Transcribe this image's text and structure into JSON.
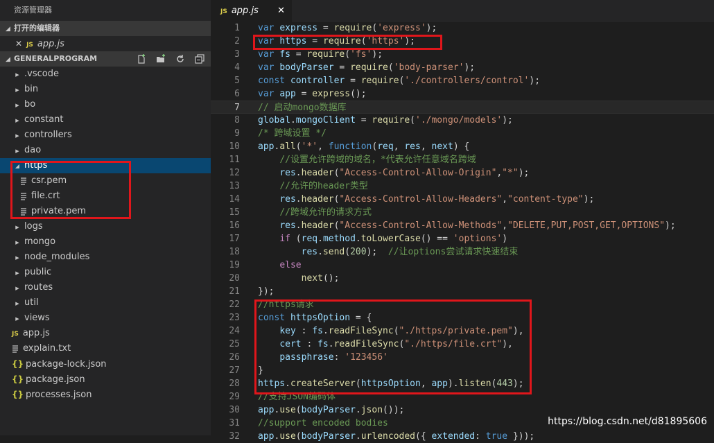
{
  "explorer_title": "资源管理器",
  "open_editors": {
    "header": "打开的编辑器",
    "items": [
      {
        "close": "✕",
        "badge": "JS",
        "name": "app.js"
      }
    ]
  },
  "project": {
    "header": "GENERALPROGRAM",
    "items": [
      {
        "name": ".vscode",
        "kind": "folder"
      },
      {
        "name": "bin",
        "kind": "folder"
      },
      {
        "name": "bo",
        "kind": "folder"
      },
      {
        "name": "constant",
        "kind": "folder"
      },
      {
        "name": "controllers",
        "kind": "folder"
      },
      {
        "name": "dao",
        "kind": "folder"
      },
      {
        "name": "https",
        "kind": "folder-open",
        "selected": true
      },
      {
        "name": "csr.pem",
        "kind": "file-lines",
        "child": true
      },
      {
        "name": "file.crt",
        "kind": "file-lines",
        "child": true
      },
      {
        "name": "private.pem",
        "kind": "file-lines",
        "child": true
      },
      {
        "name": "logs",
        "kind": "folder"
      },
      {
        "name": "mongo",
        "kind": "folder"
      },
      {
        "name": "node_modules",
        "kind": "folder"
      },
      {
        "name": "public",
        "kind": "folder"
      },
      {
        "name": "routes",
        "kind": "folder"
      },
      {
        "name": "util",
        "kind": "folder"
      },
      {
        "name": "views",
        "kind": "folder"
      },
      {
        "name": "app.js",
        "kind": "js"
      },
      {
        "name": "explain.txt",
        "kind": "file-lines"
      },
      {
        "name": "package-lock.json",
        "kind": "json"
      },
      {
        "name": "package.json",
        "kind": "json"
      },
      {
        "name": "processes.json",
        "kind": "json"
      }
    ]
  },
  "tab": {
    "badge": "JS",
    "name": "app.js",
    "close": "✕"
  },
  "code_lines": [
    [
      [
        "kw",
        "var"
      ],
      [
        "p",
        " "
      ],
      [
        "var",
        "express"
      ],
      [
        "p",
        " = "
      ],
      [
        "fn",
        "require"
      ],
      [
        "p",
        "("
      ],
      [
        "str",
        "'express'"
      ],
      [
        "p",
        ");"
      ]
    ],
    [
      [
        "kw",
        "var"
      ],
      [
        "p",
        " "
      ],
      [
        "var",
        "https"
      ],
      [
        "p",
        " = "
      ],
      [
        "fn",
        "require"
      ],
      [
        "p",
        "("
      ],
      [
        "str",
        "'https'"
      ],
      [
        "p",
        ");"
      ]
    ],
    [
      [
        "kw",
        "var"
      ],
      [
        "p",
        " "
      ],
      [
        "var",
        "fs"
      ],
      [
        "p",
        " = "
      ],
      [
        "fn",
        "require"
      ],
      [
        "p",
        "("
      ],
      [
        "str",
        "'fs'"
      ],
      [
        "p",
        ");"
      ]
    ],
    [
      [
        "kw",
        "var"
      ],
      [
        "p",
        " "
      ],
      [
        "var",
        "bodyParser"
      ],
      [
        "p",
        " = "
      ],
      [
        "fn",
        "require"
      ],
      [
        "p",
        "("
      ],
      [
        "str",
        "'body-parser'"
      ],
      [
        "p",
        ");"
      ]
    ],
    [
      [
        "kw",
        "const"
      ],
      [
        "p",
        " "
      ],
      [
        "var",
        "controller"
      ],
      [
        "p",
        " = "
      ],
      [
        "fn",
        "require"
      ],
      [
        "p",
        "("
      ],
      [
        "str",
        "'./controllers/control'"
      ],
      [
        "p",
        ");"
      ]
    ],
    [
      [
        "kw",
        "var"
      ],
      [
        "p",
        " "
      ],
      [
        "var",
        "app"
      ],
      [
        "p",
        " = "
      ],
      [
        "fn",
        "express"
      ],
      [
        "p",
        "();"
      ]
    ],
    [
      [
        "cm",
        "// 启动mongo数据库"
      ]
    ],
    [
      [
        "var",
        "global"
      ],
      [
        "p",
        "."
      ],
      [
        "var",
        "mongoClient"
      ],
      [
        "p",
        " = "
      ],
      [
        "fn",
        "require"
      ],
      [
        "p",
        "("
      ],
      [
        "str",
        "'./mongo/models'"
      ],
      [
        "p",
        ");"
      ]
    ],
    [
      [
        "cm",
        "/* 跨域设置 */"
      ]
    ],
    [
      [
        "var",
        "app"
      ],
      [
        "p",
        "."
      ],
      [
        "fn",
        "all"
      ],
      [
        "p",
        "("
      ],
      [
        "str",
        "'*'"
      ],
      [
        "p",
        ", "
      ],
      [
        "kw",
        "function"
      ],
      [
        "p",
        "("
      ],
      [
        "var",
        "req"
      ],
      [
        "p",
        ", "
      ],
      [
        "var",
        "res"
      ],
      [
        "p",
        ", "
      ],
      [
        "var",
        "next"
      ],
      [
        "p",
        ") {"
      ]
    ],
    [
      [
        "p",
        "    "
      ],
      [
        "cm",
        "//设置允许跨域的域名，*代表允许任意域名跨域"
      ]
    ],
    [
      [
        "p",
        "    "
      ],
      [
        "var",
        "res"
      ],
      [
        "p",
        "."
      ],
      [
        "fn",
        "header"
      ],
      [
        "p",
        "("
      ],
      [
        "str",
        "\"Access-Control-Allow-Origin\""
      ],
      [
        "p",
        ","
      ],
      [
        "str",
        "\"*\""
      ],
      [
        "p",
        ");"
      ]
    ],
    [
      [
        "p",
        "    "
      ],
      [
        "cm",
        "//允许的header类型"
      ]
    ],
    [
      [
        "p",
        "    "
      ],
      [
        "var",
        "res"
      ],
      [
        "p",
        "."
      ],
      [
        "fn",
        "header"
      ],
      [
        "p",
        "("
      ],
      [
        "str",
        "\"Access-Control-Allow-Headers\""
      ],
      [
        "p",
        ","
      ],
      [
        "str",
        "\"content-type\""
      ],
      [
        "p",
        ");"
      ]
    ],
    [
      [
        "p",
        "    "
      ],
      [
        "cm",
        "//跨域允许的请求方式"
      ]
    ],
    [
      [
        "p",
        "    "
      ],
      [
        "var",
        "res"
      ],
      [
        "p",
        "."
      ],
      [
        "fn",
        "header"
      ],
      [
        "p",
        "("
      ],
      [
        "str",
        "\"Access-Control-Allow-Methods\""
      ],
      [
        "p",
        ","
      ],
      [
        "str",
        "\"DELETE,PUT,POST,GET,OPTIONS\""
      ],
      [
        "p",
        ");"
      ]
    ],
    [
      [
        "p",
        "    "
      ],
      [
        "kw2",
        "if"
      ],
      [
        "p",
        " ("
      ],
      [
        "var",
        "req"
      ],
      [
        "p",
        "."
      ],
      [
        "var",
        "method"
      ],
      [
        "p",
        "."
      ],
      [
        "fn",
        "toLowerCase"
      ],
      [
        "p",
        "() == "
      ],
      [
        "str",
        "'options'"
      ],
      [
        "p",
        ")"
      ]
    ],
    [
      [
        "p",
        "        "
      ],
      [
        "var",
        "res"
      ],
      [
        "p",
        "."
      ],
      [
        "fn",
        "send"
      ],
      [
        "p",
        "("
      ],
      [
        "num",
        "200"
      ],
      [
        "p",
        ");  "
      ],
      [
        "cm",
        "//让options尝试请求快速结束"
      ]
    ],
    [
      [
        "p",
        "    "
      ],
      [
        "kw2",
        "else"
      ]
    ],
    [
      [
        "p",
        "        "
      ],
      [
        "fn",
        "next"
      ],
      [
        "p",
        "();"
      ]
    ],
    [
      [
        "p",
        "});"
      ]
    ],
    [
      [
        "cm",
        "//https请求"
      ]
    ],
    [
      [
        "kw",
        "const"
      ],
      [
        "p",
        " "
      ],
      [
        "var",
        "httpsOption"
      ],
      [
        "p",
        " = {"
      ]
    ],
    [
      [
        "p",
        "    "
      ],
      [
        "var",
        "key"
      ],
      [
        "p",
        " : "
      ],
      [
        "var",
        "fs"
      ],
      [
        "p",
        "."
      ],
      [
        "fn",
        "readFileSync"
      ],
      [
        "p",
        "("
      ],
      [
        "str",
        "\"./https/private.pem\""
      ],
      [
        "p",
        "),"
      ]
    ],
    [
      [
        "p",
        "    "
      ],
      [
        "var",
        "cert"
      ],
      [
        "p",
        " : "
      ],
      [
        "var",
        "fs"
      ],
      [
        "p",
        "."
      ],
      [
        "fn",
        "readFileSync"
      ],
      [
        "p",
        "("
      ],
      [
        "str",
        "\"./https/file.crt\""
      ],
      [
        "p",
        "),"
      ]
    ],
    [
      [
        "p",
        "    "
      ],
      [
        "var",
        "passphrase"
      ],
      [
        "p",
        ": "
      ],
      [
        "str",
        "'123456'"
      ]
    ],
    [
      [
        "p",
        "}"
      ]
    ],
    [
      [
        "var",
        "https"
      ],
      [
        "p",
        "."
      ],
      [
        "fn",
        "createServer"
      ],
      [
        "p",
        "("
      ],
      [
        "var",
        "httpsOption"
      ],
      [
        "p",
        ", "
      ],
      [
        "var",
        "app"
      ],
      [
        "p",
        ")."
      ],
      [
        "fn",
        "listen"
      ],
      [
        "p",
        "("
      ],
      [
        "num",
        "443"
      ],
      [
        "p",
        ");"
      ]
    ],
    [
      [
        "cm",
        "//支持JSON编码体"
      ]
    ],
    [
      [
        "var",
        "app"
      ],
      [
        "p",
        "."
      ],
      [
        "fn",
        "use"
      ],
      [
        "p",
        "("
      ],
      [
        "var",
        "bodyParser"
      ],
      [
        "p",
        "."
      ],
      [
        "fn",
        "json"
      ],
      [
        "p",
        "());"
      ]
    ],
    [
      [
        "cm",
        "//support encoded bodies"
      ]
    ],
    [
      [
        "var",
        "app"
      ],
      [
        "p",
        "."
      ],
      [
        "fn",
        "use"
      ],
      [
        "p",
        "("
      ],
      [
        "var",
        "bodyParser"
      ],
      [
        "p",
        "."
      ],
      [
        "fn",
        "urlencoded"
      ],
      [
        "p",
        "({ "
      ],
      [
        "var",
        "extended"
      ],
      [
        "p",
        ": "
      ],
      [
        "kw",
        "true"
      ],
      [
        "p",
        " }));"
      ]
    ]
  ],
  "current_line": 7,
  "colors": {
    "kw": "#569cd6",
    "kw2": "#c586c0",
    "var": "#9cdcfe",
    "fn": "#dcdcaa",
    "str": "#ce9178",
    "cm": "#6a9955",
    "num": "#b5cea8",
    "p": "#d4d4d4"
  },
  "watermark": "https://blog.csdn.net/d81895606"
}
